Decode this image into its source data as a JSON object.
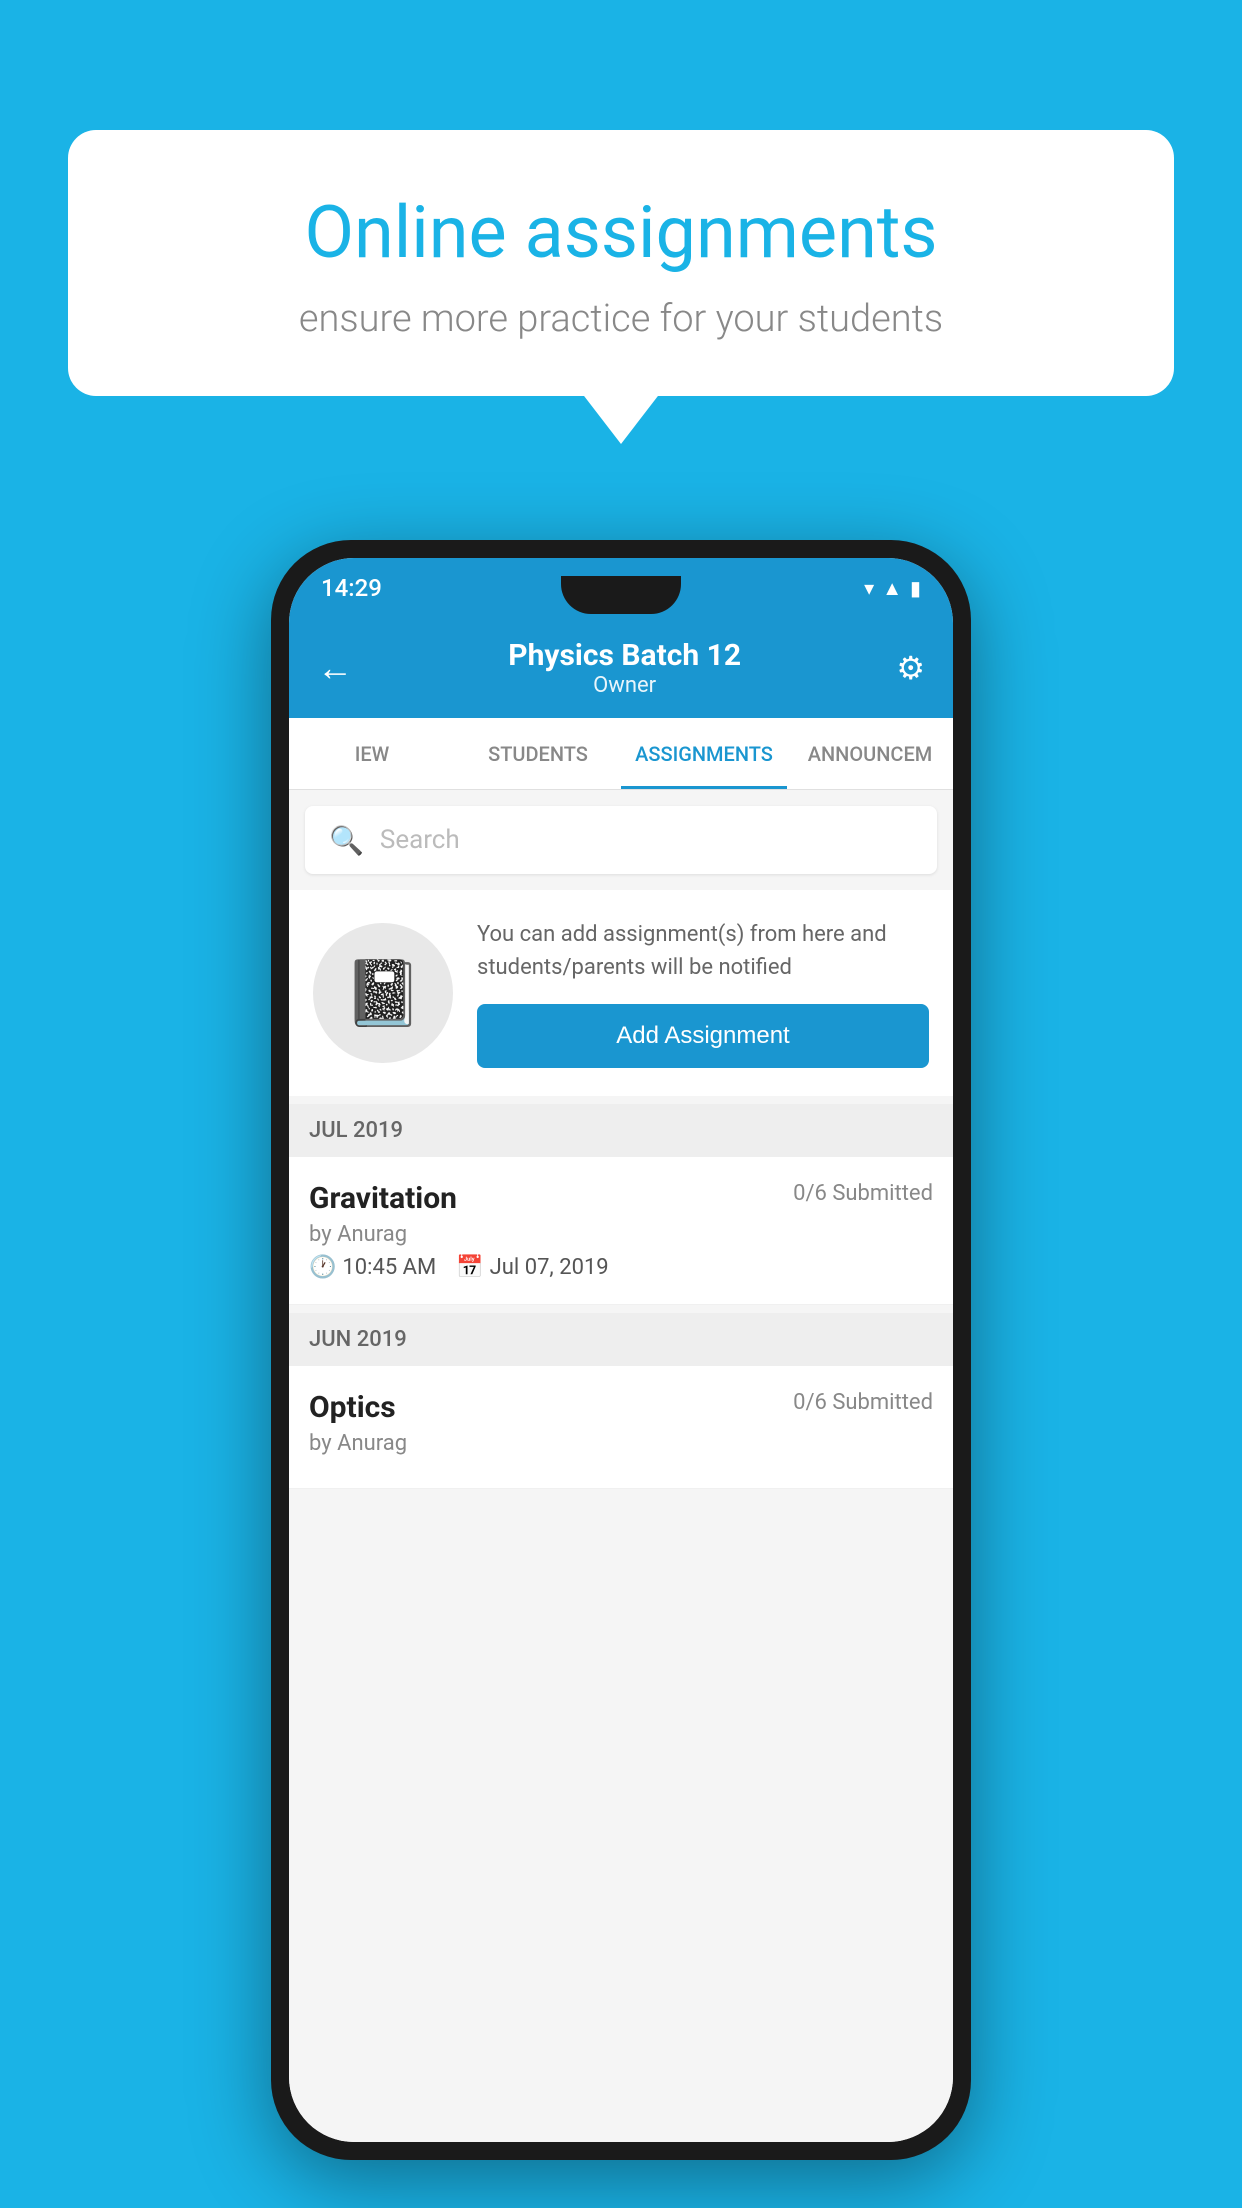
{
  "background_color": "#1ab3e6",
  "speech_bubble": {
    "title": "Online assignments",
    "subtitle": "ensure more practice for your students"
  },
  "phone": {
    "status_bar": {
      "time": "14:29",
      "icons": [
        "wifi",
        "signal",
        "battery"
      ]
    },
    "app_bar": {
      "title": "Physics Batch 12",
      "subtitle": "Owner",
      "back_label": "←",
      "settings_label": "⚙"
    },
    "tabs": [
      {
        "label": "IEW",
        "active": false
      },
      {
        "label": "STUDENTS",
        "active": false
      },
      {
        "label": "ASSIGNMENTS",
        "active": true
      },
      {
        "label": "ANNOUNCEM",
        "active": false
      }
    ],
    "search": {
      "placeholder": "Search"
    },
    "add_assignment_section": {
      "description": "You can add assignment(s) from here and students/parents will be notified",
      "button_label": "Add Assignment"
    },
    "sections": [
      {
        "month": "JUL 2019",
        "assignments": [
          {
            "title": "Gravitation",
            "submitted": "0/6 Submitted",
            "by": "by Anurag",
            "time": "10:45 AM",
            "date": "Jul 07, 2019"
          }
        ]
      },
      {
        "month": "JUN 2019",
        "assignments": [
          {
            "title": "Optics",
            "submitted": "0/6 Submitted",
            "by": "by Anurag",
            "time": "",
            "date": ""
          }
        ]
      }
    ]
  }
}
